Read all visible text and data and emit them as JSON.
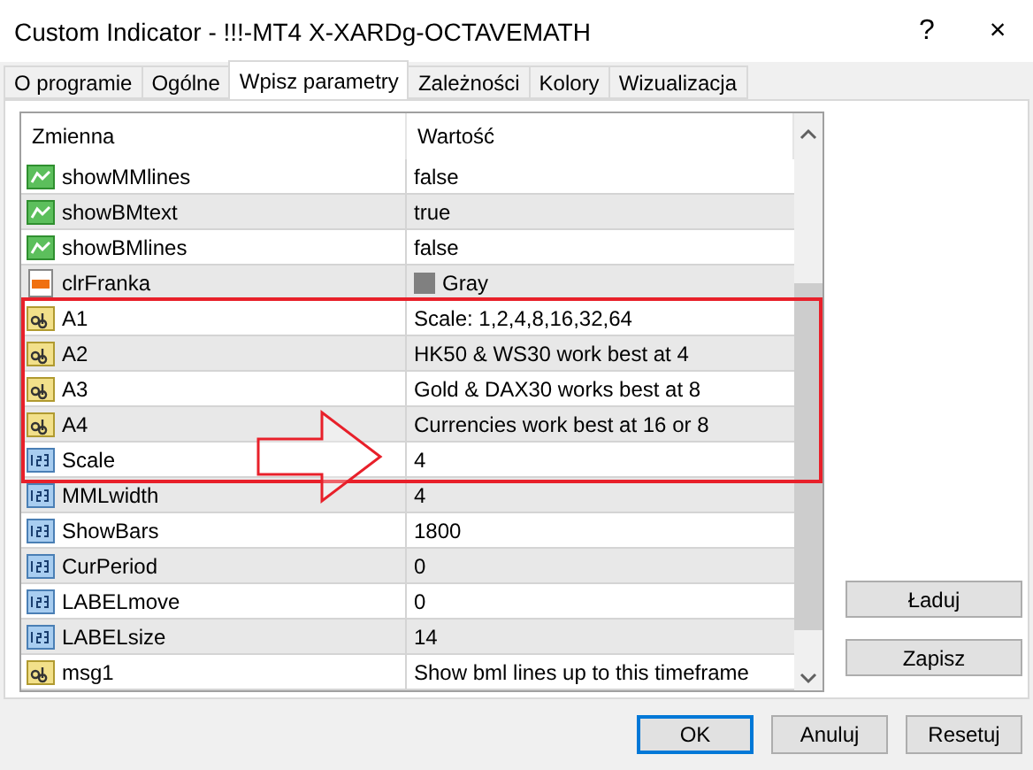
{
  "window": {
    "title": "Custom Indicator - !!!-MT4 X-XARDg-OCTAVEMATH",
    "help": "?",
    "close": "×"
  },
  "tabs": [
    {
      "label": "O programie",
      "selected": false
    },
    {
      "label": "Ogólne",
      "selected": false
    },
    {
      "label": "Wpisz parametry",
      "selected": true
    },
    {
      "label": "Zależności",
      "selected": false
    },
    {
      "label": "Kolory",
      "selected": false
    },
    {
      "label": "Wizualizacja",
      "selected": false
    }
  ],
  "table": {
    "columns": [
      "Zmienna",
      "Wartość"
    ],
    "rows": [
      {
        "kind": "bool",
        "name": "showMMlines",
        "value": "false"
      },
      {
        "kind": "bool",
        "name": "showBMtext",
        "value": "true"
      },
      {
        "kind": "bool",
        "name": "showBMlines",
        "value": "false"
      },
      {
        "kind": "color",
        "name": "clrFranka",
        "value": "Gray",
        "color": "#808080"
      },
      {
        "kind": "string",
        "name": "A1",
        "value": "Scale: 1,2,4,8,16,32,64"
      },
      {
        "kind": "string",
        "name": "A2",
        "value": "HK50 & WS30 work best at 4"
      },
      {
        "kind": "string",
        "name": "A3",
        "value": "Gold & DAX30 works best at 8"
      },
      {
        "kind": "string",
        "name": "A4",
        "value": "Currencies work best at 16 or 8"
      },
      {
        "kind": "int",
        "name": "Scale",
        "value": "4"
      },
      {
        "kind": "int",
        "name": "MMLwidth",
        "value": "4"
      },
      {
        "kind": "int",
        "name": "ShowBars",
        "value": "1800"
      },
      {
        "kind": "int",
        "name": "CurPeriod",
        "value": "0"
      },
      {
        "kind": "int",
        "name": "LABELmove",
        "value": "0"
      },
      {
        "kind": "int",
        "name": "LABELsize",
        "value": "14"
      },
      {
        "kind": "string",
        "name": "msg1",
        "value": "Show bml lines up to this timeframe"
      }
    ]
  },
  "side_buttons": [
    "Ładuj",
    "Zapisz"
  ],
  "buttons": [
    "OK",
    "Anuluj",
    "Resetuj"
  ],
  "annotations": [
    {
      "kind": "box"
    },
    {
      "kind": "arrow"
    }
  ]
}
